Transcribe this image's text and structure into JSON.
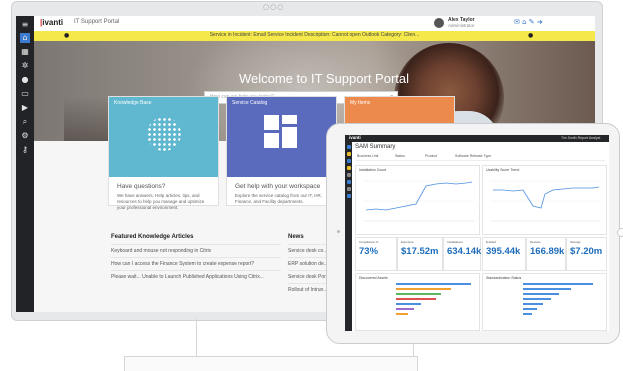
{
  "window": {
    "camera_dots": "○○○"
  },
  "portal": {
    "brand_ivanti": "ivanti",
    "app_title": "IT Support Portal",
    "user_name": "Alex Taylor",
    "user_role": "Administrator",
    "banner_text": "Service in Incident: Email Service Incident Description: Cannot open Outlook Category: Clien...",
    "hero_title": "Welcome to IT Support Portal",
    "search_placeholder": "How can we help you today?",
    "cards": [
      {
        "label": "Knowledge Base",
        "color": "#5fb8cf",
        "title": "Have questions?",
        "desc": "We have answers. Help articles, tips, and resources to help you manage and optimize your professional environment."
      },
      {
        "label": "Service Catalog",
        "color": "#5a6bbd",
        "title": "Get help with your workspace",
        "desc": "Explore the service catalog from our IT, HR, Finance, and Facility departments."
      },
      {
        "label": "My Items",
        "color": "#ec8a4d",
        "title": "",
        "desc": ""
      }
    ],
    "kb_title": "Featured Knowledge Articles",
    "kb_articles": [
      "Keyboard and mouse not responding in Citrix",
      "How can I access the Finance System to create expense report?",
      "Please wait... Unable to Launch Published Applications Using Citrix..."
    ],
    "news_title": "News",
    "news_items": [
      "Service desk co...",
      "ERP solution de...",
      "Service desk Por...",
      "Rollout of Intrun..."
    ]
  },
  "tablet": {
    "logo": "ivanti",
    "topbar_right": "Tim Smith  Report Analyst",
    "dashboard_title": "SAM Summary",
    "filters": [
      "Business Unit",
      "Status",
      "Product",
      "Software Release Type"
    ],
    "panel_titles": [
      "Installation Count",
      "Usability Score Trend"
    ],
    "bottom_panels": [
      "Discovered Assets",
      "Standardization Status"
    ],
    "kpis": [
      {
        "label": "Compliance %",
        "value": "73%",
        "color": "#1e6dbb"
      },
      {
        "label": "Exposure",
        "value": "$17.52m",
        "color": "#1e6dbb"
      },
      {
        "label": "Installations",
        "value": "634.14k",
        "color": "#1e6dbb"
      },
      {
        "label": "Entitled",
        "value": "395.44k",
        "color": "#1e6dbb"
      },
      {
        "label": "Devices",
        "value": "166.89k",
        "color": "#1e6dbb"
      },
      {
        "label": "Savings",
        "value": "$7.20m",
        "color": "#1e6dbb"
      }
    ]
  },
  "colors": {
    "banner": "#f5e84a",
    "sidebar": "#222326",
    "accent": "#3b7bd0"
  }
}
